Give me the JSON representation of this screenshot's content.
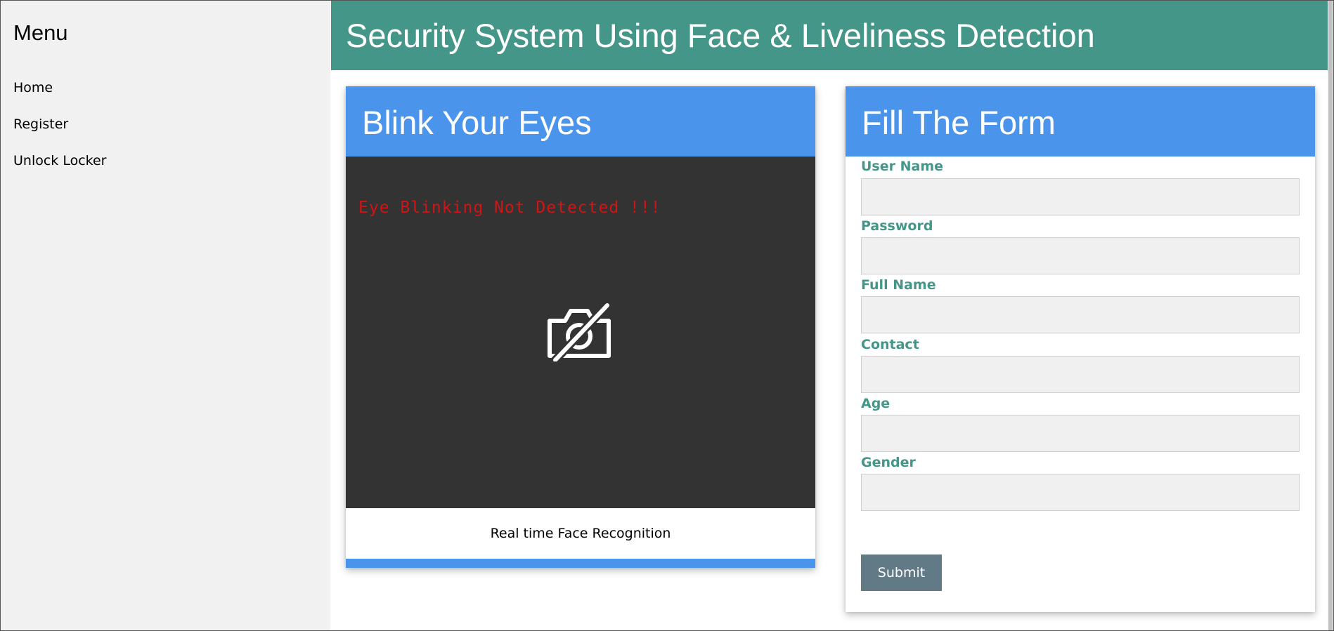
{
  "sidebar": {
    "title": "Menu",
    "items": [
      {
        "label": "Home"
      },
      {
        "label": "Register"
      },
      {
        "label": "Unlock Locker"
      }
    ]
  },
  "header": {
    "title": "Security System Using Face & Liveliness Detection"
  },
  "video_card": {
    "title": "Blink Your Eyes",
    "status_text": "Eye Blinking Not Detected !!!",
    "icon": "camera-off-icon",
    "caption": "Real time Face Recognition"
  },
  "form_card": {
    "title": "Fill The Form",
    "fields": [
      {
        "label": "User Name",
        "value": ""
      },
      {
        "label": "Password",
        "value": ""
      },
      {
        "label": "Full Name",
        "value": ""
      },
      {
        "label": "Contact",
        "value": ""
      },
      {
        "label": "Age",
        "value": ""
      },
      {
        "label": "Gender",
        "value": ""
      }
    ],
    "submit_label": "Submit"
  },
  "colors": {
    "header_bg": "#449688",
    "card_header_bg": "#4a94eb",
    "sidebar_bg": "#f1f1f1",
    "label_color": "#449688",
    "status_red": "#d11414",
    "submit_bg": "#627a85",
    "video_bg": "#333333"
  }
}
